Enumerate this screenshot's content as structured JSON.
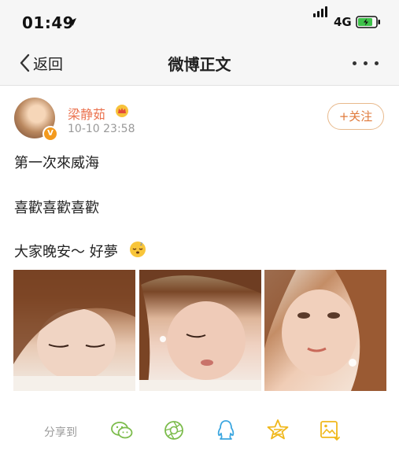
{
  "status_bar": {
    "time": "01:49",
    "network": "4G"
  },
  "nav": {
    "back_label": "返回",
    "title": "微博正文"
  },
  "post": {
    "author": "梁静茹",
    "time": "10-10 23:58",
    "follow_label": "+关注",
    "verified_badge": "V",
    "lines": [
      "第一次來威海",
      "喜歡喜歡喜歡",
      "大家晚安～ 好夢"
    ],
    "photos": 3
  },
  "share": {
    "label": "分享到",
    "targets": [
      "wechat-icon",
      "moments-icon",
      "qq-icon",
      "qzone-icon",
      "save-image-icon"
    ]
  },
  "colors": {
    "accent": "#eb7350",
    "follow_border": "#e8b98c",
    "share_icon": "#7cbc4c",
    "qq": "#3ba6e0",
    "qzone": "#f0b81d"
  }
}
